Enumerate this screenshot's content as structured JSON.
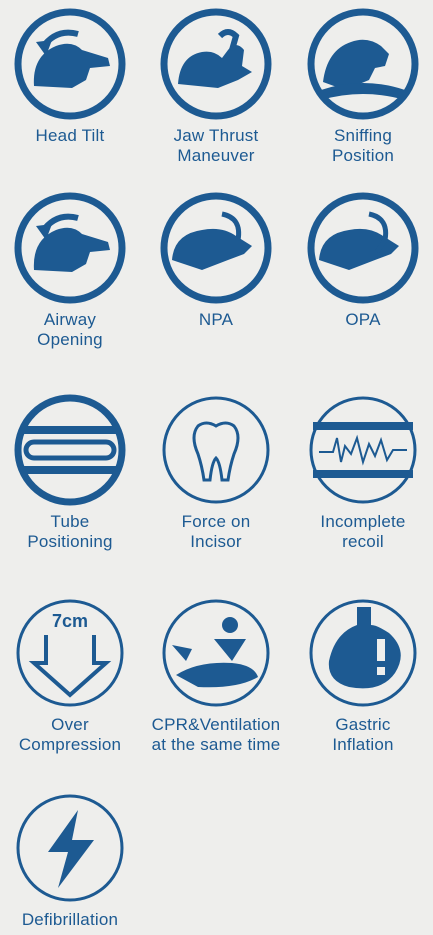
{
  "colors": {
    "primary": "#1d5a92",
    "background": "#eeeeec"
  },
  "items": [
    {
      "label": "Head Tilt",
      "icon": "head-tilt-icon"
    },
    {
      "label": "Jaw Thrust\nManeuver",
      "icon": "jaw-thrust-icon"
    },
    {
      "label": "Sniffing\nPosition",
      "icon": "sniffing-position-icon"
    },
    {
      "label": "Airway\nOpening",
      "icon": "airway-opening-icon"
    },
    {
      "label": "NPA",
      "icon": "npa-icon"
    },
    {
      "label": "OPA",
      "icon": "opa-icon"
    },
    {
      "label": "Tube\nPositioning",
      "icon": "tube-positioning-icon"
    },
    {
      "label": "Force on\nIncisor",
      "icon": "tooth-icon"
    },
    {
      "label": "Incomplete\nrecoil",
      "icon": "waveform-icon"
    },
    {
      "label": "Over\nCompression",
      "icon": "down-arrow-icon",
      "badge": "7cm"
    },
    {
      "label": "CPR&Ventilation\nat the same time",
      "icon": "cpr-ventilation-icon"
    },
    {
      "label": "Gastric\nInflation",
      "icon": "stomach-icon"
    },
    {
      "label": "Defibrillation",
      "icon": "lightning-bolt-icon"
    }
  ]
}
